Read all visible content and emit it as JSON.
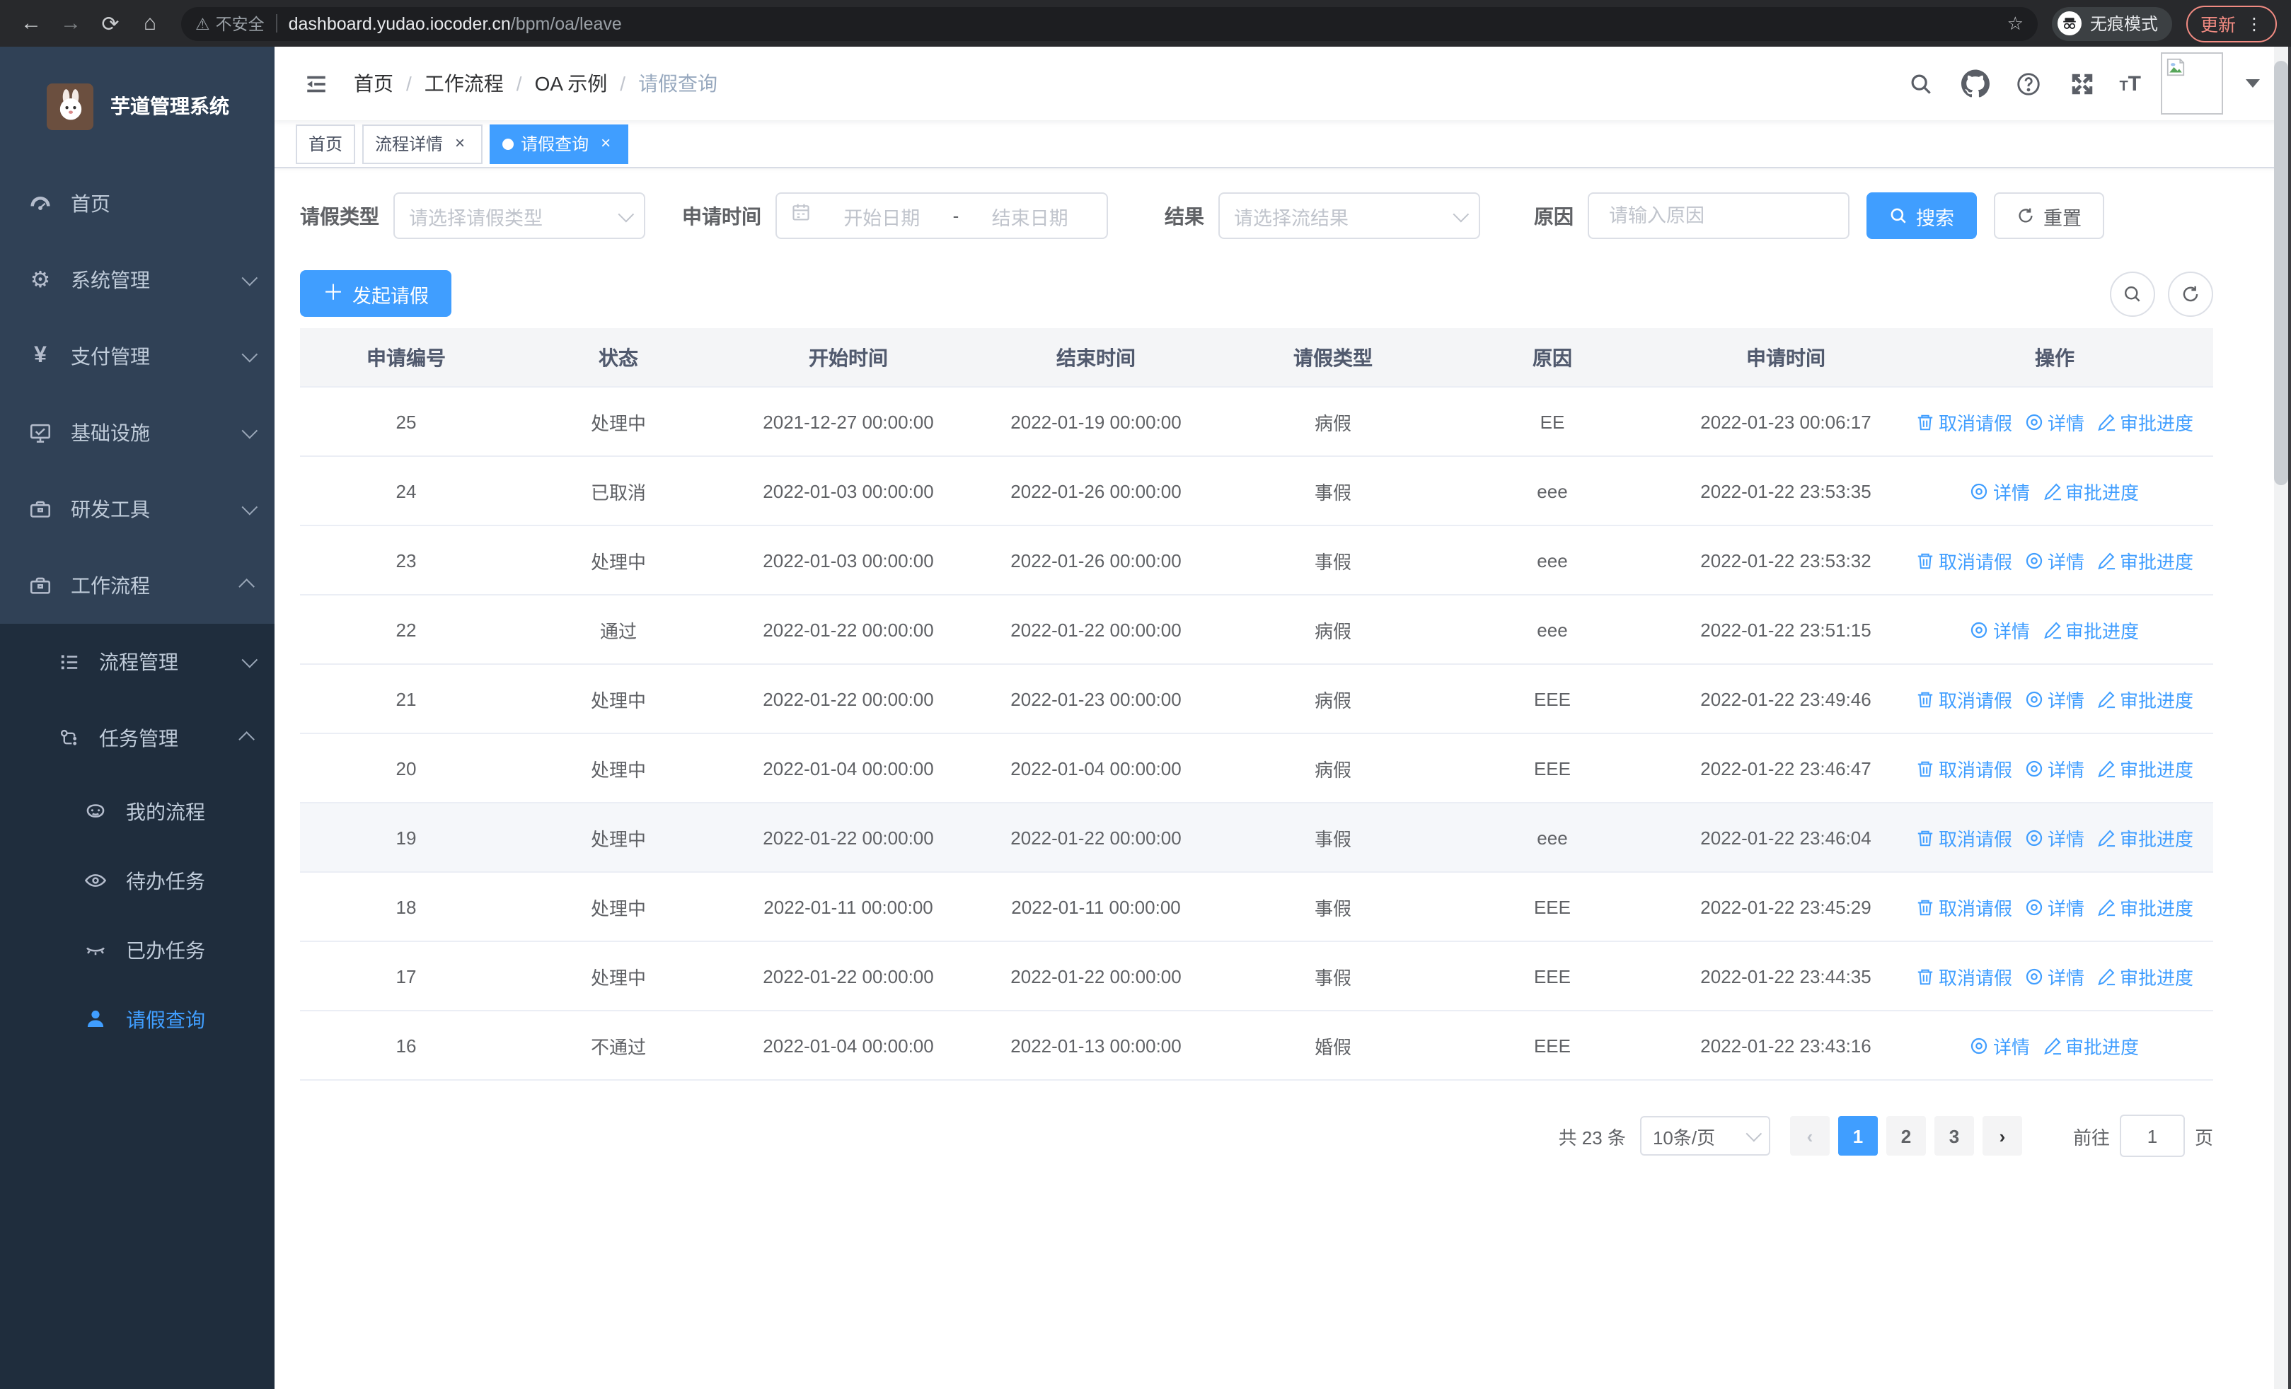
{
  "browser": {
    "security_label": "不安全",
    "url_host": "dashboard.yudao.iocoder.cn",
    "url_path": "/bpm/oa/leave",
    "incognito_label": "无痕模式",
    "update_label": "更新"
  },
  "sidebar": {
    "app_title": "芋道管理系统",
    "items": [
      {
        "label": "首页"
      },
      {
        "label": "系统管理"
      },
      {
        "label": "支付管理"
      },
      {
        "label": "基础设施"
      },
      {
        "label": "研发工具"
      },
      {
        "label": "工作流程"
      }
    ],
    "submenu": {
      "items": [
        {
          "label": "流程管理"
        },
        {
          "label": "任务管理"
        },
        {
          "label": "我的流程"
        },
        {
          "label": "待办任务"
        },
        {
          "label": "已办任务"
        },
        {
          "label": "请假查询"
        }
      ]
    }
  },
  "header": {
    "breadcrumb": [
      "首页",
      "工作流程",
      "OA 示例",
      "请假查询"
    ]
  },
  "tabs": [
    {
      "label": "首页",
      "closable": false,
      "active": false
    },
    {
      "label": "流程详情",
      "closable": true,
      "active": false
    },
    {
      "label": "请假查询",
      "closable": true,
      "active": true
    }
  ],
  "filters": {
    "leave_type_label": "请假类型",
    "leave_type_placeholder": "请选择请假类型",
    "apply_time_label": "申请时间",
    "start_date_placeholder": "开始日期",
    "range_separator": "-",
    "end_date_placeholder": "结束日期",
    "result_label": "结果",
    "result_placeholder": "请选择流结果",
    "reason_label": "原因",
    "reason_placeholder": "请输入原因",
    "search_label": "搜索",
    "reset_label": "重置"
  },
  "toolbar": {
    "create_label": "发起请假"
  },
  "table": {
    "headers": [
      "申请编号",
      "状态",
      "开始时间",
      "结束时间",
      "请假类型",
      "原因",
      "申请时间",
      "操作"
    ],
    "action_labels": {
      "cancel": "取消请假",
      "detail": "详情",
      "progress": "审批进度"
    },
    "rows": [
      {
        "id": "25",
        "status": "处理中",
        "start": "2021-12-27 00:00:00",
        "end": "2022-01-19 00:00:00",
        "type": "病假",
        "reason": "EE",
        "apply_time": "2022-01-23 00:06:17",
        "actions": [
          "cancel",
          "detail",
          "progress"
        ],
        "highlighted": false
      },
      {
        "id": "24",
        "status": "已取消",
        "start": "2022-01-03 00:00:00",
        "end": "2022-01-26 00:00:00",
        "type": "事假",
        "reason": "eee",
        "apply_time": "2022-01-22 23:53:35",
        "actions": [
          "detail",
          "progress"
        ],
        "highlighted": false
      },
      {
        "id": "23",
        "status": "处理中",
        "start": "2022-01-03 00:00:00",
        "end": "2022-01-26 00:00:00",
        "type": "事假",
        "reason": "eee",
        "apply_time": "2022-01-22 23:53:32",
        "actions": [
          "cancel",
          "detail",
          "progress"
        ],
        "highlighted": false
      },
      {
        "id": "22",
        "status": "通过",
        "start": "2022-01-22 00:00:00",
        "end": "2022-01-22 00:00:00",
        "type": "病假",
        "reason": "eee",
        "apply_time": "2022-01-22 23:51:15",
        "actions": [
          "detail",
          "progress"
        ],
        "highlighted": false
      },
      {
        "id": "21",
        "status": "处理中",
        "start": "2022-01-22 00:00:00",
        "end": "2022-01-23 00:00:00",
        "type": "病假",
        "reason": "EEE",
        "apply_time": "2022-01-22 23:49:46",
        "actions": [
          "cancel",
          "detail",
          "progress"
        ],
        "highlighted": false
      },
      {
        "id": "20",
        "status": "处理中",
        "start": "2022-01-04 00:00:00",
        "end": "2022-01-04 00:00:00",
        "type": "病假",
        "reason": "EEE",
        "apply_time": "2022-01-22 23:46:47",
        "actions": [
          "cancel",
          "detail",
          "progress"
        ],
        "highlighted": false
      },
      {
        "id": "19",
        "status": "处理中",
        "start": "2022-01-22 00:00:00",
        "end": "2022-01-22 00:00:00",
        "type": "事假",
        "reason": "eee",
        "apply_time": "2022-01-22 23:46:04",
        "actions": [
          "cancel",
          "detail",
          "progress"
        ],
        "highlighted": true
      },
      {
        "id": "18",
        "status": "处理中",
        "start": "2022-01-11 00:00:00",
        "end": "2022-01-11 00:00:00",
        "type": "事假",
        "reason": "EEE",
        "apply_time": "2022-01-22 23:45:29",
        "actions": [
          "cancel",
          "detail",
          "progress"
        ],
        "highlighted": false
      },
      {
        "id": "17",
        "status": "处理中",
        "start": "2022-01-22 00:00:00",
        "end": "2022-01-22 00:00:00",
        "type": "事假",
        "reason": "EEE",
        "apply_time": "2022-01-22 23:44:35",
        "actions": [
          "cancel",
          "detail",
          "progress"
        ],
        "highlighted": false
      },
      {
        "id": "16",
        "status": "不通过",
        "start": "2022-01-04 00:00:00",
        "end": "2022-01-13 00:00:00",
        "type": "婚假",
        "reason": "EEE",
        "apply_time": "2022-01-22 23:43:16",
        "actions": [
          "detail",
          "progress"
        ],
        "highlighted": false
      }
    ]
  },
  "pagination": {
    "total_label": "共 23 条",
    "page_size_label": "10条/页",
    "pages": [
      "1",
      "2",
      "3"
    ],
    "active_page": "1",
    "goto_label": "前往",
    "goto_value": "1",
    "goto_suffix": "页"
  },
  "colors": {
    "primary": "#409eff",
    "sidebar_bg": "#304156",
    "submenu_bg": "#1f2d3d",
    "sidebar_text": "#bfcbd9"
  }
}
